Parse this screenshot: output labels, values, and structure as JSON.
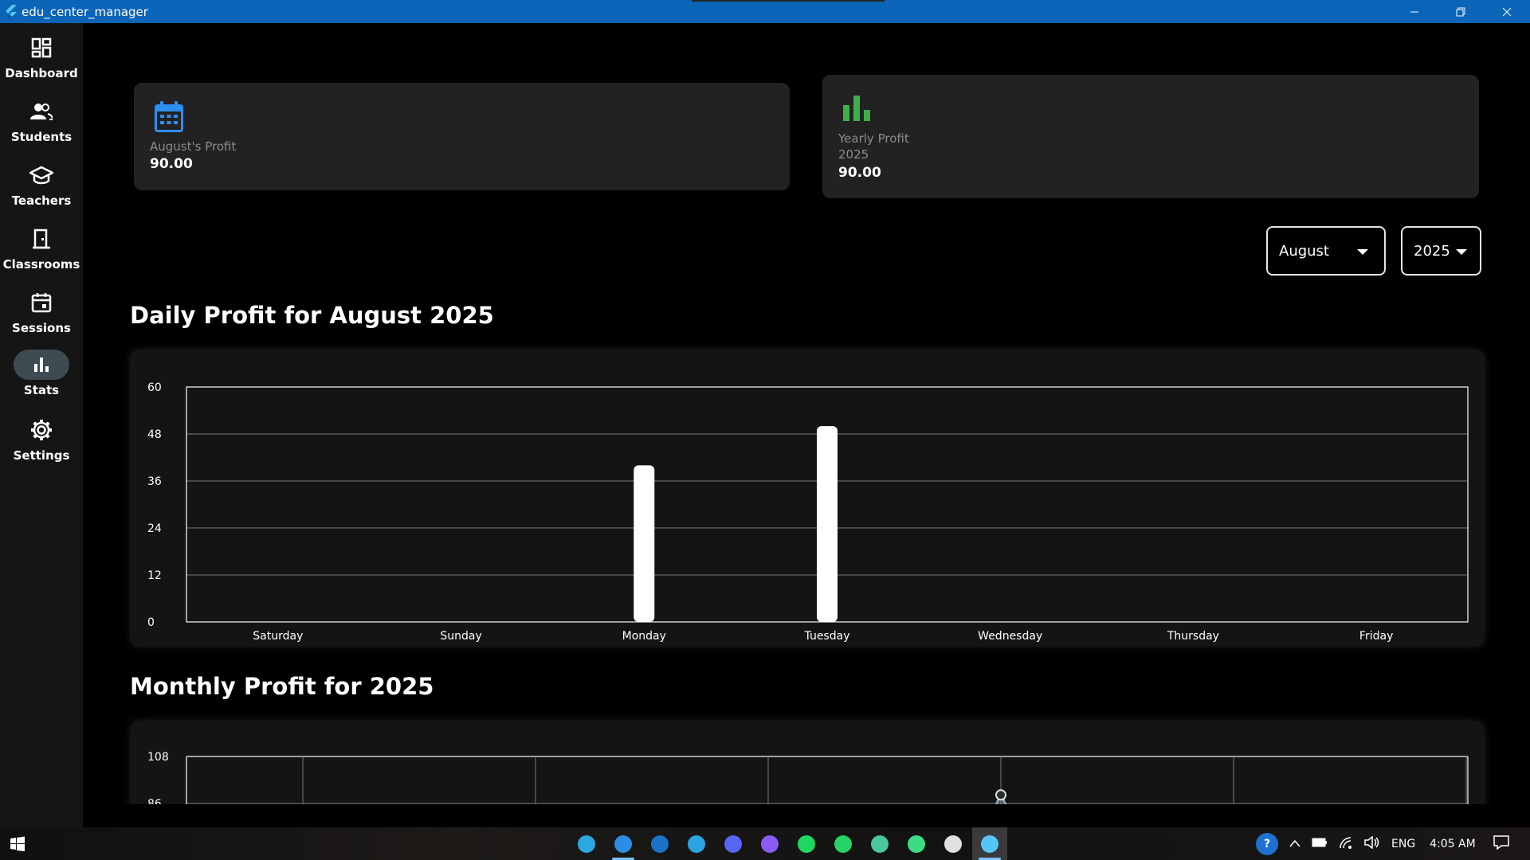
{
  "window": {
    "title": "edu_center_manager"
  },
  "sidebar": {
    "items": [
      {
        "label": "Dashboard",
        "icon": "dashboard-icon"
      },
      {
        "label": "Students",
        "icon": "people-icon"
      },
      {
        "label": "Teachers",
        "icon": "graduation-cap-icon"
      },
      {
        "label": "Classrooms",
        "icon": "door-icon"
      },
      {
        "label": "Sessions",
        "icon": "calendar-icon"
      },
      {
        "label": "Stats",
        "icon": "bar-chart-icon",
        "active": true
      },
      {
        "label": "Settings",
        "icon": "gear-icon"
      }
    ]
  },
  "cards": {
    "monthly": {
      "label": "August's Profit",
      "value": "90.00",
      "icon": "calendar-icon",
      "icon_color": "#2f8ff0"
    },
    "yearly": {
      "label": "Yearly Profit",
      "year": "2025",
      "value": "90.00",
      "icon": "bar-chart-icon",
      "icon_color": "#3fae4a"
    }
  },
  "filters": {
    "month": "August",
    "year": "2025"
  },
  "sections": {
    "daily_title": "Daily Profit for August 2025",
    "monthly_title": "Monthly Profit for 2025"
  },
  "chart_data": [
    {
      "type": "bar",
      "categories": [
        "Saturday",
        "Sunday",
        "Monday",
        "Tuesday",
        "Wednesday",
        "Thursday",
        "Friday"
      ],
      "values": [
        0,
        0,
        40,
        50,
        0,
        0,
        0
      ],
      "ylim": [
        0,
        60
      ],
      "yticks": [
        0,
        12,
        24,
        36,
        48,
        60
      ],
      "grid": true,
      "bar_color": "#ffffff"
    },
    {
      "type": "line",
      "x": [
        0,
        1,
        2,
        3,
        4,
        5
      ],
      "values": [
        null,
        null,
        null,
        90,
        null,
        null
      ],
      "ylim": [
        86,
        108
      ],
      "yticks": [
        86,
        108
      ],
      "grid": true,
      "line_color": "#8fa3ad"
    }
  ],
  "taskbar": {
    "apps": [
      "edge-icon",
      "vscode-icon",
      "outlook-icon",
      "telegram-icon",
      "discord-icon",
      "obsidian-icon",
      "spotify-icon",
      "whatsapp-icon",
      "photos-icon",
      "android-icon",
      "notepad-icon",
      "flutter-icon"
    ],
    "language": "ENG",
    "time": "4:05 AM"
  }
}
